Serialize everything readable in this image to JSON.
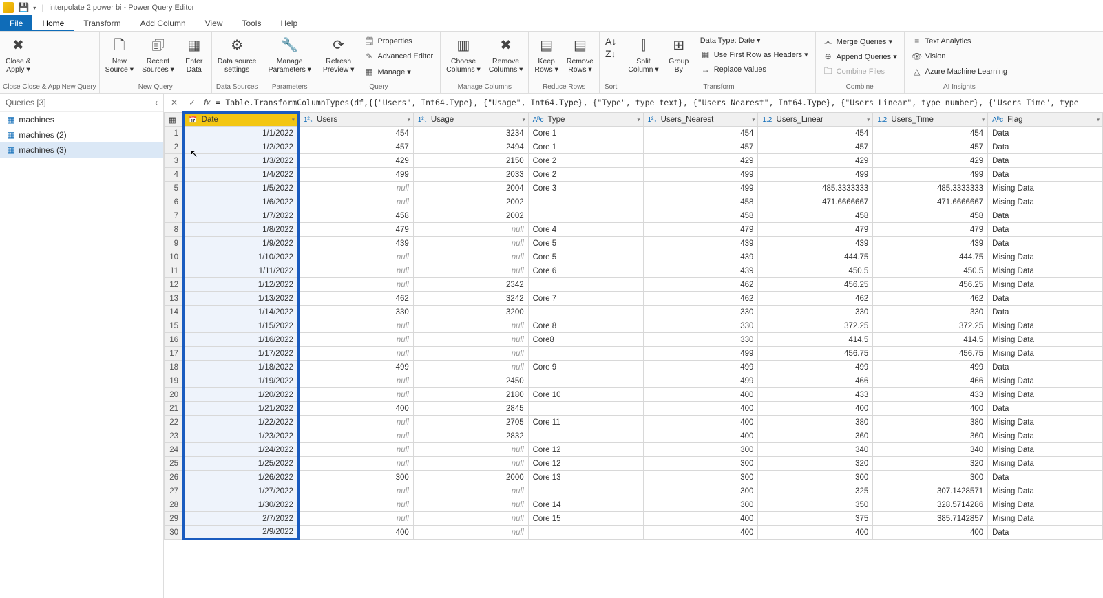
{
  "title": "interpolate 2 power bi - Power Query Editor",
  "menu": {
    "file": "File",
    "home": "Home",
    "transform": "Transform",
    "addcol": "Add Column",
    "view": "View",
    "tools": "Tools",
    "help": "Help"
  },
  "ribbon": {
    "closeApply": {
      "title": "Close & Apply",
      "label": "Close &\nApply ▾"
    },
    "newSource": "New\nSource ▾",
    "recentSources": "Recent\nSources ▾",
    "enterData": "Enter\nData",
    "newQuery": "New Query",
    "dataSourceSettings": "Data source\nsettings",
    "dataSources": "Data Sources",
    "manageParams": "Manage\nParameters ▾",
    "parameters": "Parameters",
    "refreshPreview": "Refresh\nPreview ▾",
    "properties": "Properties",
    "advEditor": "Advanced Editor",
    "manage": "Manage ▾",
    "queryGrp": "Query",
    "chooseCols": "Choose\nColumns ▾",
    "removeCols": "Remove\nColumns ▾",
    "manageCols": "Manage Columns",
    "keepRows": "Keep\nRows ▾",
    "removeRows": "Remove\nRows ▾",
    "reduceRows": "Reduce Rows",
    "sortGrp": "Sort",
    "splitCol": "Split\nColumn ▾",
    "groupBy": "Group\nBy",
    "dataType": "Data Type: Date ▾",
    "useFirstRow": "Use First Row as Headers ▾",
    "replaceVals": "Replace Values",
    "transformGrp": "Transform",
    "mergeQ": "Merge Queries ▾",
    "appendQ": "Append Queries ▾",
    "combineFiles": "Combine Files",
    "combineGrp": "Combine",
    "textAnalytics": "Text Analytics",
    "vision": "Vision",
    "azureML": "Azure Machine Learning",
    "aiGrp": "AI Insights"
  },
  "tooltip": {
    "title": "Close & Apply",
    "desc": "Close Close & ApplNew Query"
  },
  "queries": {
    "title": "Queries [3]",
    "closeText": "Close",
    "items": [
      {
        "label": "machines"
      },
      {
        "label": "machines (2)"
      },
      {
        "label": "machines (3)",
        "selected": true
      }
    ]
  },
  "formula": "= Table.TransformColumnTypes(df,{{\"Users\", Int64.Type}, {\"Usage\", Int64.Type}, {\"Type\", type text}, {\"Users_Nearest\", Int64.Type}, {\"Users_Linear\", type number}, {\"Users_Time\", type",
  "columns": [
    {
      "icon": "📅",
      "label": "Date",
      "selected": true
    },
    {
      "icon": "1²₃",
      "label": "Users"
    },
    {
      "icon": "1²₃",
      "label": "Usage"
    },
    {
      "icon": "Aᴮc",
      "label": "Type"
    },
    {
      "icon": "1²₃",
      "label": "Users_Nearest"
    },
    {
      "icon": "1.2",
      "label": "Users_Linear"
    },
    {
      "icon": "1.2",
      "label": "Users_Time"
    },
    {
      "icon": "Aᴮc",
      "label": "Flag"
    }
  ],
  "rows": [
    [
      "1/1/2022",
      "454",
      "3234",
      "Core 1",
      "454",
      "454",
      "454",
      "Data"
    ],
    [
      "1/2/2022",
      "457",
      "2494",
      "Core 1",
      "457",
      "457",
      "457",
      "Data"
    ],
    [
      "1/3/2022",
      "429",
      "2150",
      "Core 2",
      "429",
      "429",
      "429",
      "Data"
    ],
    [
      "1/4/2022",
      "499",
      "2033",
      "Core 2",
      "499",
      "499",
      "499",
      "Data"
    ],
    [
      "1/5/2022",
      "null",
      "2004",
      "Core 3",
      "499",
      "485.3333333",
      "485.3333333",
      "Mising Data"
    ],
    [
      "1/6/2022",
      "null",
      "2002",
      "",
      "458",
      "471.6666667",
      "471.6666667",
      "Mising Data"
    ],
    [
      "1/7/2022",
      "458",
      "2002",
      "",
      "458",
      "458",
      "458",
      "Data"
    ],
    [
      "1/8/2022",
      "479",
      "null",
      "Core 4",
      "479",
      "479",
      "479",
      "Data"
    ],
    [
      "1/9/2022",
      "439",
      "null",
      "Core 5",
      "439",
      "439",
      "439",
      "Data"
    ],
    [
      "1/10/2022",
      "null",
      "null",
      "Core 5",
      "439",
      "444.75",
      "444.75",
      "Mising Data"
    ],
    [
      "1/11/2022",
      "null",
      "null",
      "Core 6",
      "439",
      "450.5",
      "450.5",
      "Mising Data"
    ],
    [
      "1/12/2022",
      "null",
      "2342",
      "",
      "462",
      "456.25",
      "456.25",
      "Mising Data"
    ],
    [
      "1/13/2022",
      "462",
      "3242",
      "Core 7",
      "462",
      "462",
      "462",
      "Data"
    ],
    [
      "1/14/2022",
      "330",
      "3200",
      "",
      "330",
      "330",
      "330",
      "Data"
    ],
    [
      "1/15/2022",
      "null",
      "null",
      "Core 8",
      "330",
      "372.25",
      "372.25",
      "Mising Data"
    ],
    [
      "1/16/2022",
      "null",
      "null",
      "Core8",
      "330",
      "414.5",
      "414.5",
      "Mising Data"
    ],
    [
      "1/17/2022",
      "null",
      "null",
      "",
      "499",
      "456.75",
      "456.75",
      "Mising Data"
    ],
    [
      "1/18/2022",
      "499",
      "null",
      "Core 9",
      "499",
      "499",
      "499",
      "Data"
    ],
    [
      "1/19/2022",
      "null",
      "2450",
      "",
      "499",
      "466",
      "466",
      "Mising Data"
    ],
    [
      "1/20/2022",
      "null",
      "2180",
      "Core 10",
      "400",
      "433",
      "433",
      "Mising Data"
    ],
    [
      "1/21/2022",
      "400",
      "2845",
      "",
      "400",
      "400",
      "400",
      "Data"
    ],
    [
      "1/22/2022",
      "null",
      "2705",
      "Core 11",
      "400",
      "380",
      "380",
      "Mising Data"
    ],
    [
      "1/23/2022",
      "null",
      "2832",
      "",
      "400",
      "360",
      "360",
      "Mising Data"
    ],
    [
      "1/24/2022",
      "null",
      "null",
      "Core 12",
      "300",
      "340",
      "340",
      "Mising Data"
    ],
    [
      "1/25/2022",
      "null",
      "null",
      "Core 12",
      "300",
      "320",
      "320",
      "Mising Data"
    ],
    [
      "1/26/2022",
      "300",
      "2000",
      "Core 13",
      "300",
      "300",
      "300",
      "Data"
    ],
    [
      "1/27/2022",
      "null",
      "null",
      "",
      "300",
      "325",
      "307.1428571",
      "Mising Data"
    ],
    [
      "1/30/2022",
      "null",
      "null",
      "Core 14",
      "300",
      "350",
      "328.5714286",
      "Mising Data"
    ],
    [
      "2/7/2022",
      "null",
      "null",
      "Core 15",
      "400",
      "375",
      "385.7142857",
      "Mising Data"
    ],
    [
      "2/9/2022",
      "400",
      "null",
      "",
      "400",
      "400",
      "400",
      "Data"
    ]
  ]
}
